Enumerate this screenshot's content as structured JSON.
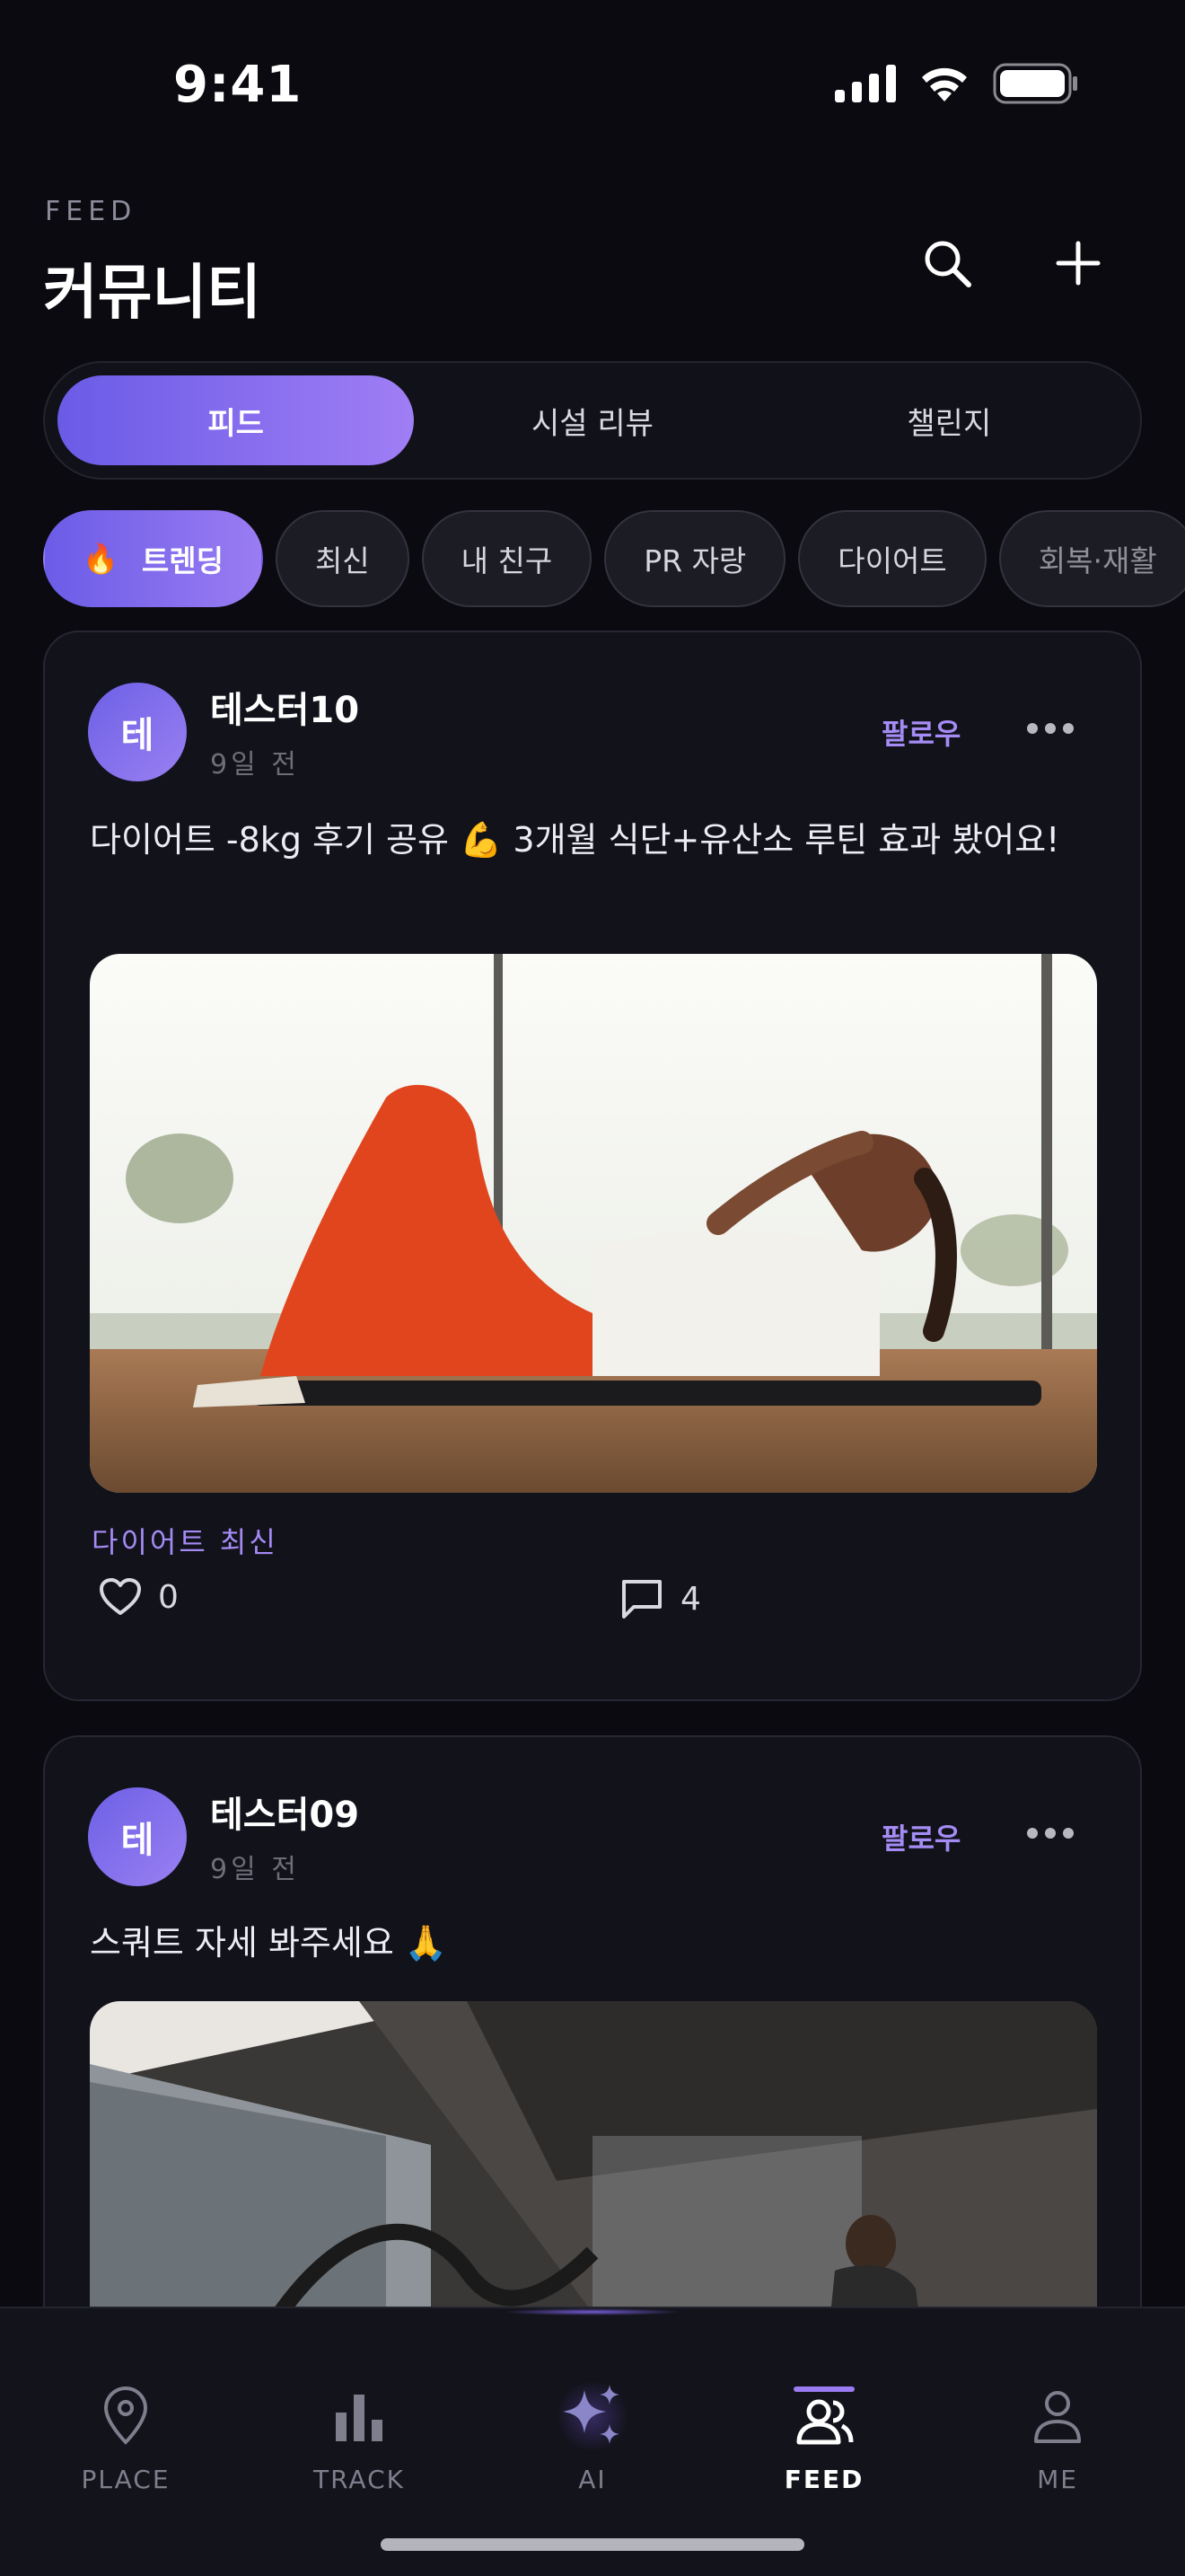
{
  "status_bar": {
    "time": "9:41"
  },
  "header": {
    "eyebrow": "FEED",
    "title": "커뮤니티"
  },
  "tabs": [
    {
      "label": "피드",
      "active": true
    },
    {
      "label": "시설 리뷰",
      "active": false
    },
    {
      "label": "챌린지",
      "active": false
    }
  ],
  "chips": [
    {
      "emoji": "🔥",
      "label": "트렌딩",
      "active": true
    },
    {
      "label": "최신"
    },
    {
      "label": "내 친구"
    },
    {
      "label": "PR 자랑"
    },
    {
      "label": "다이어트"
    },
    {
      "label": "회복·재활"
    }
  ],
  "posts": [
    {
      "avatar_initial": "테",
      "author": "테스터10",
      "time": "9일 전",
      "follow_label": "팔로우",
      "text": "다이어트 -8kg 후기 공유 💪 3개월 식단+유산소 루틴 효과 봤어요!",
      "image": "woman doing crunches on a mat in a bright gym",
      "tags": "다이어트 최신",
      "likes": "0",
      "comments": "4"
    },
    {
      "avatar_initial": "테",
      "author": "테스터09",
      "time": "9일 전",
      "follow_label": "팔로우",
      "text": "스쿼트 자세 봐주세요 🙏",
      "image": "man training with battle ropes under a concrete structure"
    }
  ],
  "nav": [
    {
      "label": "PLACE",
      "icon": "map-pin-icon",
      "active": false
    },
    {
      "label": "TRACK",
      "icon": "bar-chart-icon",
      "active": false
    },
    {
      "label": "AI",
      "icon": "sparkles-icon",
      "active": false
    },
    {
      "label": "FEED",
      "icon": "community-icon",
      "active": true
    },
    {
      "label": "ME",
      "icon": "person-icon",
      "active": false
    }
  ],
  "colors": {
    "accent": "#9a7cf2",
    "background": "#0a0a10",
    "card": "#12121b"
  }
}
